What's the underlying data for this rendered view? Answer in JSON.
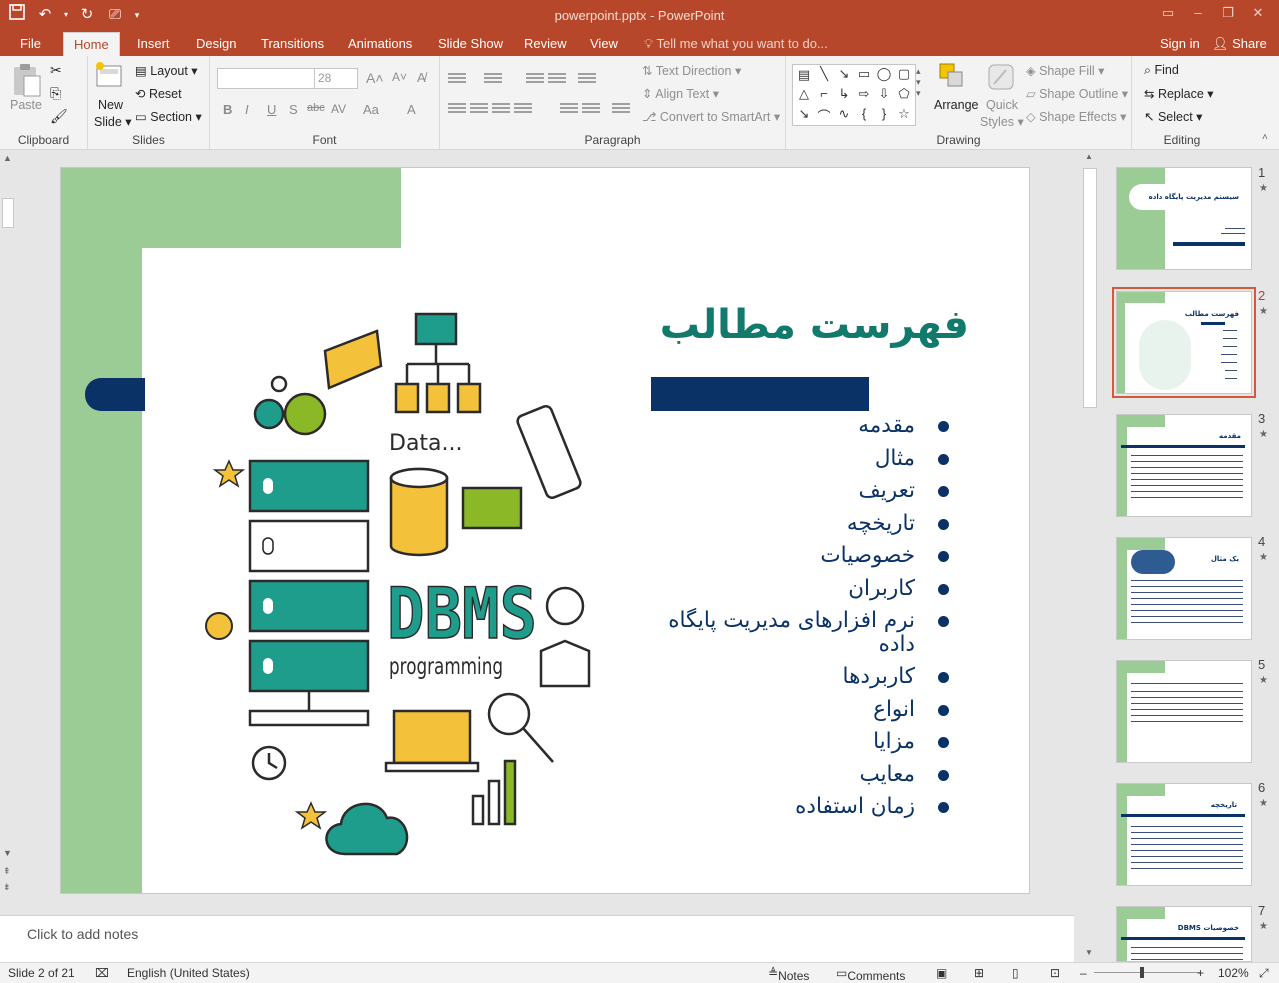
{
  "window": {
    "title": "powerpoint.pptx - PowerPoint"
  },
  "tabs": [
    "File",
    "Home",
    "Insert",
    "Design",
    "Transitions",
    "Animations",
    "Slide Show",
    "Review",
    "View"
  ],
  "active_tab": "Home",
  "tell_me": "Tell me what you want to do...",
  "account": {
    "sign_in": "Sign in",
    "share": "Share"
  },
  "ribbon": {
    "clipboard": {
      "label": "Clipboard",
      "paste": "Paste"
    },
    "slides": {
      "label": "Slides",
      "new_slide": "New",
      "new_slide2": "Slide",
      "layout": "Layout",
      "reset": "Reset",
      "section": "Section"
    },
    "font": {
      "label": "Font",
      "size": "28",
      "bold": "B",
      "italic": "I",
      "underline": "U",
      "shadow": "S",
      "strike": "abc",
      "spacing": "AV",
      "case": "Aa",
      "color": "A"
    },
    "paragraph": {
      "label": "Paragraph",
      "text_direction": "Text Direction",
      "align_text": "Align Text",
      "smartart": "Convert to SmartArt"
    },
    "drawing": {
      "label": "Drawing",
      "arrange": "Arrange",
      "quick_styles": "Quick",
      "quick_styles2": "Styles",
      "shape_fill": "Shape Fill",
      "shape_outline": "Shape Outline",
      "shape_effects": "Shape Effects"
    },
    "editing": {
      "label": "Editing",
      "find": "Find",
      "replace": "Replace",
      "select": "Select"
    }
  },
  "slide": {
    "heading": "فهرست مطالب",
    "items": [
      "مقدمه",
      "مثال",
      "تعریف",
      "تاریخچه",
      "خصوصیات",
      "کاربران",
      "نرم افزارهای مدیریت پایگاه داده",
      "کاربردها",
      "انواع",
      "مزایا",
      "معایب",
      "زمان استفاده"
    ],
    "illustration": {
      "data_label": "Data...",
      "dbms": "DBMS",
      "programming": "programming"
    }
  },
  "notes_placeholder": "Click to add notes",
  "thumbnails": [
    {
      "num": "1",
      "title": "سیستم مدیریت پایگاه داده"
    },
    {
      "num": "2",
      "title": "فهرست مطالب"
    },
    {
      "num": "3",
      "title": "مقدمه"
    },
    {
      "num": "4",
      "title": "یک مثال"
    },
    {
      "num": "5",
      "title": ""
    },
    {
      "num": "6",
      "title": "تاریخچه"
    },
    {
      "num": "7",
      "title": "خصوصیات DBMS"
    }
  ],
  "status": {
    "slide": "Slide 2 of 21",
    "language": "English (United States)",
    "notes": "Notes",
    "comments": "Comments",
    "zoom": "102%"
  },
  "colors": {
    "accent": "#b7472a",
    "navy": "#0a3266",
    "teal_heading": "#117a6c",
    "green": "#9ccc95"
  }
}
